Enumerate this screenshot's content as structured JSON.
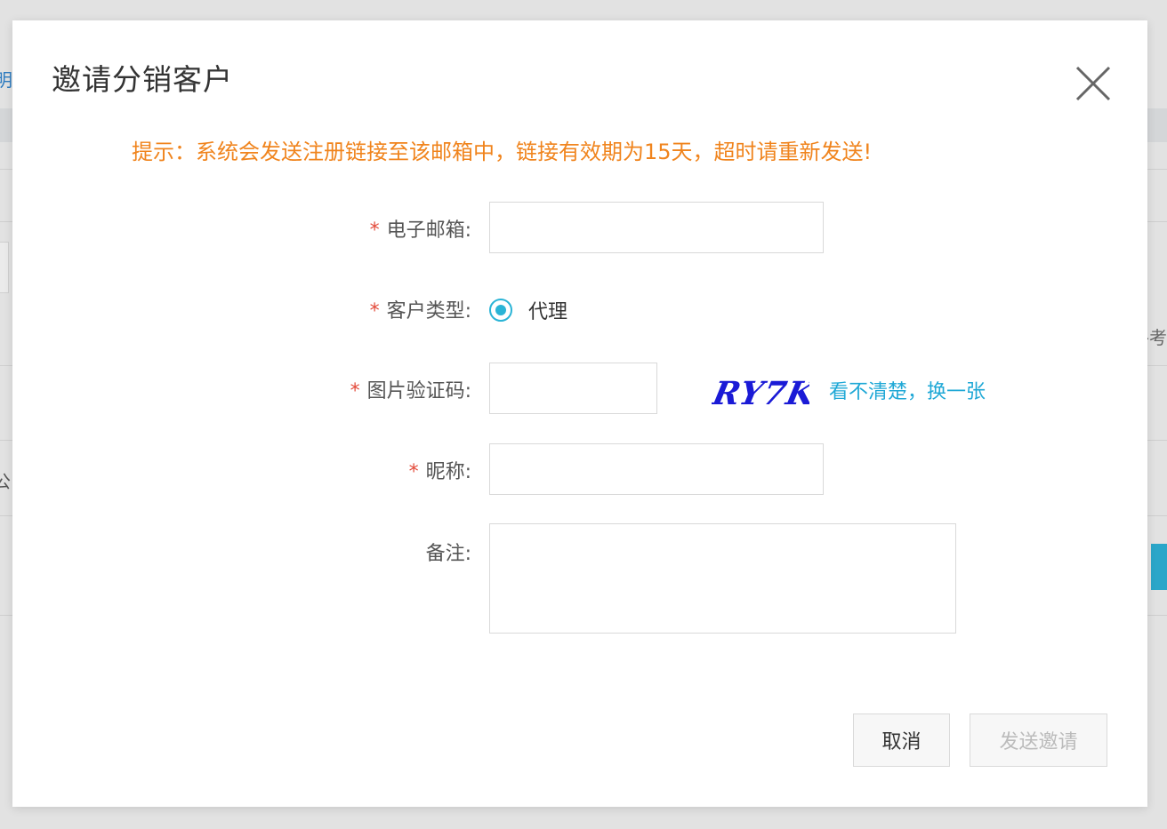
{
  "background": {
    "left_fragment": "明细",
    "right_fragment": "-考",
    "left_fragment2": "公"
  },
  "modal": {
    "title": "邀请分销客户",
    "close_icon": "close-icon",
    "notice": "提示：系统会发送注册链接至该邮箱中，链接有效期为15天，超时请重新发送!"
  },
  "form": {
    "required_mark": "*",
    "email": {
      "label": "电子邮箱:",
      "value": "",
      "placeholder": ""
    },
    "customer_type": {
      "label": "客户类型:",
      "option_label": "代理",
      "selected": true
    },
    "captcha": {
      "label": "图片验证码:",
      "value": "",
      "captcha_text": "RY7K",
      "refresh_link": "看不清楚，换一张"
    },
    "nickname": {
      "label": "昵称:",
      "value": ""
    },
    "remark": {
      "label": "备注:",
      "value": ""
    }
  },
  "buttons": {
    "cancel": "取消",
    "send": "发送邀请"
  },
  "colors": {
    "notice": "#f0841d",
    "accent": "#2ab4d6",
    "link": "#1fa8d6",
    "required": "#e34a3a",
    "captcha": "#1a1ad6"
  }
}
